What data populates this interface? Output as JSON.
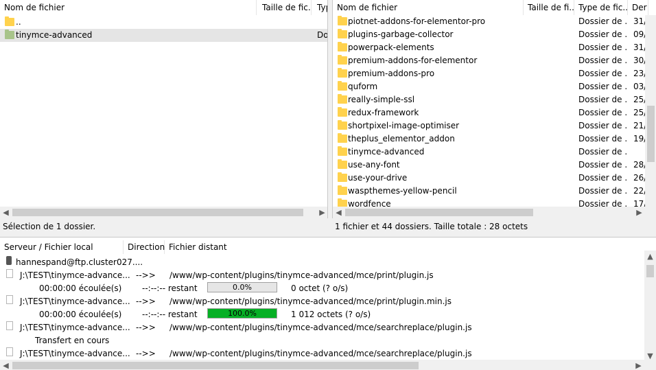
{
  "left": {
    "columns": [
      "Nom de fichier",
      "Taille de fic...",
      "Typ"
    ],
    "rows": [
      {
        "name": "..",
        "type": ""
      },
      {
        "name": "tinymce-advanced",
        "type": "Do"
      }
    ],
    "status": "Sélection de 1 dossier."
  },
  "right": {
    "columns": [
      "Nom de fichier",
      "Taille de fi...",
      "Type de fic...",
      "Der"
    ],
    "rows": [
      {
        "name": "piotnet-addons-for-elementor-pro",
        "type": "Dossier de ...",
        "date": "31/"
      },
      {
        "name": "plugins-garbage-collector",
        "type": "Dossier de ...",
        "date": "09/"
      },
      {
        "name": "powerpack-elements",
        "type": "Dossier de ...",
        "date": "31/"
      },
      {
        "name": "premium-addons-for-elementor",
        "type": "Dossier de ...",
        "date": "30/"
      },
      {
        "name": "premium-addons-pro",
        "type": "Dossier de ...",
        "date": "23/"
      },
      {
        "name": "quform",
        "type": "Dossier de ...",
        "date": "03/"
      },
      {
        "name": "really-simple-ssl",
        "type": "Dossier de ...",
        "date": "25/"
      },
      {
        "name": "redux-framework",
        "type": "Dossier de ...",
        "date": "25/"
      },
      {
        "name": "shortpixel-image-optimiser",
        "type": "Dossier de ...",
        "date": "21/"
      },
      {
        "name": "theplus_elementor_addon",
        "type": "Dossier de ...",
        "date": "19/"
      },
      {
        "name": "tinymce-advanced",
        "type": "Dossier de ...",
        "date": ""
      },
      {
        "name": "use-any-font",
        "type": "Dossier de ...",
        "date": "28/"
      },
      {
        "name": "use-your-drive",
        "type": "Dossier de ...",
        "date": "26/"
      },
      {
        "name": "waspthemes-yellow-pencil",
        "type": "Dossier de ...",
        "date": "22/"
      },
      {
        "name": "wordfence",
        "type": "Dossier de ...",
        "date": "17/"
      }
    ],
    "status": "1 fichier et 44 dossiers. Taille totale : 28 octets"
  },
  "queue": {
    "columns": [
      "Serveur / Fichier local",
      "Direction",
      "Fichier distant"
    ],
    "server": "hannespand@ftp.cluster027....",
    "items": [
      {
        "local": "J:\\TEST\\tinymce-advance...",
        "direction": "-->>",
        "remote": "/www/wp-content/plugins/tinymce-advanced/mce/print/plugin.js",
        "progress": {
          "elapsed": "00:00:00 écoulée(s)",
          "remaining": "--:--:-- restant",
          "percent_label": "0.0%",
          "percent": 0,
          "bytes": "0 octet (? o/s)"
        }
      },
      {
        "local": "J:\\TEST\\tinymce-advance...",
        "direction": "-->>",
        "remote": "/www/wp-content/plugins/tinymce-advanced/mce/print/plugin.min.js",
        "progress": {
          "elapsed": "00:00:00 écoulée(s)",
          "remaining": "--:--:-- restant",
          "percent_label": "100.0%",
          "percent": 100,
          "bytes": "1 012 octets (? o/s)"
        }
      },
      {
        "local": "J:\\TEST\\tinymce-advance...",
        "direction": "-->>",
        "remote": "/www/wp-content/plugins/tinymce-advanced/mce/searchreplace/plugin.js",
        "note": "Transfert en cours"
      },
      {
        "local": "J:\\TEST\\tinymce-advance...",
        "direction": "-->>",
        "remote": "/www/wp-content/plugins/tinymce-advanced/mce/searchreplace/plugin.js"
      }
    ]
  },
  "icons": {
    "folder": "folder-icon",
    "file": "file-icon",
    "server": "server-icon"
  },
  "colors": {
    "folder": "#ffd24d",
    "selected_folder": "#a8c48a",
    "progress_fill": "#06b025"
  }
}
